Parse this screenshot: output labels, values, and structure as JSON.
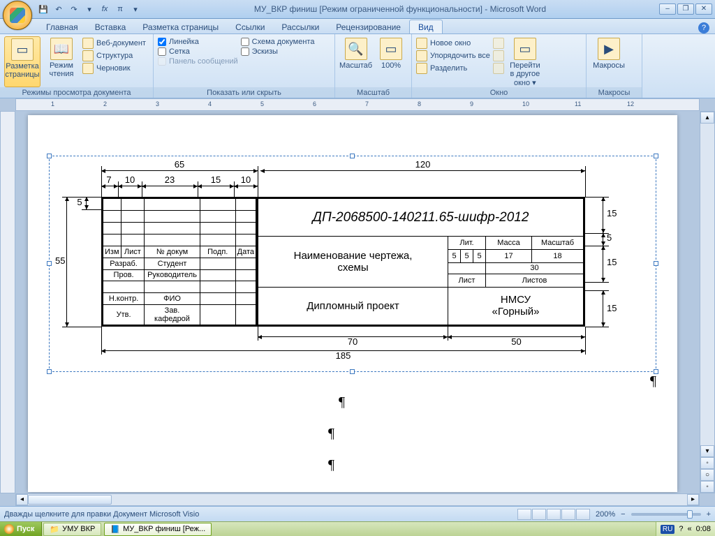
{
  "title": "МУ_ВКР финиш [Режим ограниченной функциональности] - Microsoft Word",
  "tabs": [
    "Главная",
    "Вставка",
    "Разметка страницы",
    "Ссылки",
    "Рассылки",
    "Рецензирование",
    "Вид"
  ],
  "activeTab": 6,
  "ribbon": {
    "views": {
      "label": "Режимы просмотра документа",
      "printLayout": "Разметка страницы",
      "reading": "Режим чтения",
      "web": "Веб-документ",
      "outline": "Структура",
      "draft": "Черновик"
    },
    "show": {
      "label": "Показать или скрыть",
      "ruler": "Линейка",
      "gridlines": "Сетка",
      "messageBar": "Панель сообщений",
      "docMap": "Схема документа",
      "thumbnails": "Эскизы"
    },
    "zoom": {
      "label": "Масштаб",
      "zoom": "Масштаб",
      "hundred": "100%"
    },
    "window": {
      "label": "Окно",
      "newWin": "Новое окно",
      "arrange": "Упорядочить все",
      "split": "Разделить",
      "switch": "Перейти в другое окно ▾"
    },
    "macros": {
      "label": "Макросы",
      "btn": "Макросы"
    }
  },
  "ruler_numbers": [
    "1",
    "2",
    "3",
    "4",
    "5",
    "6",
    "7",
    "8",
    "9",
    "10",
    "11",
    "12"
  ],
  "drawing": {
    "dims_top": {
      "w65": "65",
      "w120": "120",
      "w7": "7",
      "w10a": "10",
      "w23": "23",
      "w15": "15",
      "w10b": "10"
    },
    "dims_left": {
      "h5": "5",
      "h55": "55"
    },
    "dims_right": {
      "h15a": "15",
      "h5": "5",
      "h15b": "15",
      "h15c": "15"
    },
    "dims_bottom": {
      "w70": "70",
      "w50": "50",
      "w185": "185"
    },
    "stamp": {
      "hdr": [
        "Изм",
        "Лист",
        "№ докум",
        "Подп.",
        "Дата"
      ],
      "rows": [
        [
          "Разраб.",
          "Студент"
        ],
        [
          "Пров.",
          "Руководитель"
        ],
        [
          "",
          ""
        ],
        [
          "Н.контр.",
          "ФИО"
        ],
        [
          "Утв.",
          "Зав. кафедрой"
        ]
      ],
      "code": "ДП-2068500-140211.65-шифр-2012",
      "title1": "Наименование чертежа,",
      "title2": "схемы",
      "project": "Дипломный проект",
      "lit": "Лит.",
      "massa": "Масса",
      "scale": "Масштаб",
      "litvals": [
        "5",
        "5",
        "5"
      ],
      "massaval": "17",
      "scaleval": "18",
      "scale30": "30",
      "list": "Лист",
      "listov": "Листов",
      "org1": "НМСУ",
      "org2": "«Горный»"
    }
  },
  "status": {
    "hint": "Дважды щелкните для правки Документ Microsoft Visio",
    "zoom": "200%"
  },
  "taskbar": {
    "start": "Пуск",
    "items": [
      "УМУ ВКР",
      "МУ_ВКР финиш [Реж..."
    ],
    "lang": "RU",
    "time": "0:08"
  }
}
